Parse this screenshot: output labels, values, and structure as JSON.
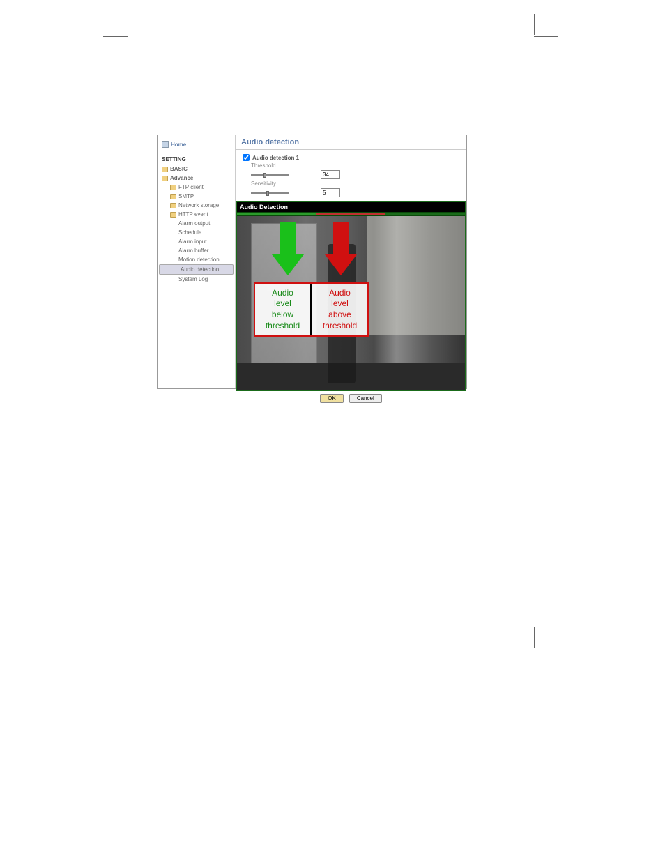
{
  "sidebar": {
    "home": "Home",
    "section": "SETTING",
    "items": [
      {
        "label": "BASIC",
        "level": 1,
        "icon": true
      },
      {
        "label": "Advance",
        "level": 1,
        "icon": true
      },
      {
        "label": "FTP client",
        "level": 2,
        "icon": true
      },
      {
        "label": "SMTP",
        "level": 2,
        "icon": true
      },
      {
        "label": "Network storage",
        "level": 2,
        "icon": true
      },
      {
        "label": "HTTP event",
        "level": 2,
        "icon": true
      },
      {
        "label": "Alarm output",
        "level": 3,
        "icon": false
      },
      {
        "label": "Schedule",
        "level": 3,
        "icon": false
      },
      {
        "label": "Alarm input",
        "level": 3,
        "icon": false
      },
      {
        "label": "Alarm buffer",
        "level": 3,
        "icon": false
      },
      {
        "label": "Motion detection",
        "level": 3,
        "icon": false
      },
      {
        "label": "Audio detection",
        "level": 3,
        "icon": false,
        "active": true
      },
      {
        "label": "System Log",
        "level": 3,
        "icon": false
      }
    ]
  },
  "main": {
    "title": "Audio detection",
    "checkbox_label": "Audio detection 1",
    "threshold_label": "Threshold",
    "threshold_value": "34",
    "sensitivity_label": "Sensitivity",
    "sensitivity_value": "5",
    "panel_title": "Audio Detection",
    "annotations": {
      "below": "Audio level below threshold",
      "above": "Audio level above threshold"
    },
    "buttons": {
      "ok": "OK",
      "cancel": "Cancel"
    }
  }
}
